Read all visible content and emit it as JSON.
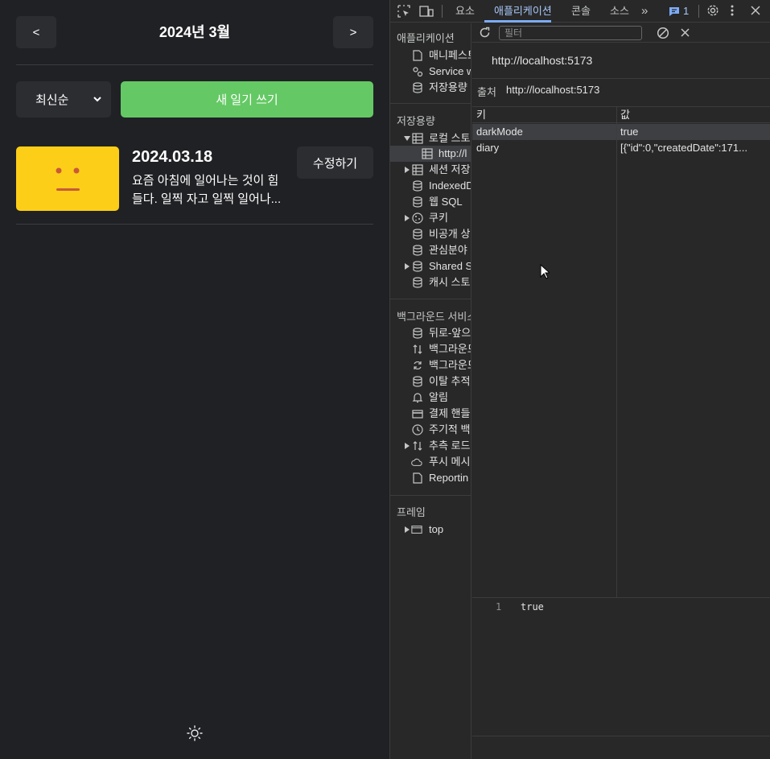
{
  "app": {
    "header": {
      "prev": "<",
      "title": "2024년 3월",
      "next": ">"
    },
    "sort": {
      "selected": "최신순"
    },
    "new_button": "새 일기 쓰기",
    "diary_item": {
      "date": "2024.03.18",
      "content": "요즘 아침에 일어나는 것이 힘들다. 일찍 자고 일찍 일어나...",
      "edit_button": "수정하기",
      "emotion_color": "#fdce17"
    },
    "theme_icon": "sun-icon"
  },
  "devtools": {
    "tabs": [
      "요소",
      "애플리케이션",
      "콘솔",
      "소스"
    ],
    "active_tab": "애플리케이션",
    "more_tabs": "»",
    "issues_count": "1",
    "sidebar": {
      "application_header": "애플리케이션",
      "application_items": [
        "매니페스트",
        "Service w",
        "저장용량"
      ],
      "storage_header": "저장용량",
      "storage_items": [
        "로컬 스토",
        "http://l",
        "세션 저장",
        "IndexedD",
        "웹 SQL",
        "쿠키",
        "비공개 상",
        "관심분야",
        "Shared S",
        "캐시 스토"
      ],
      "background_header": "백그라운드 서비스",
      "background_items": [
        "뒤로-앞으",
        "백그라운드",
        "백그라운드",
        "이탈 추적",
        "알림",
        "결제 핸들",
        "주기적 백",
        "추측 로드",
        "푸시 메시",
        "Reportin"
      ],
      "frames_header": "프레임",
      "frames_items": [
        "top"
      ]
    },
    "toolbar": {
      "filter_placeholder": "필터"
    },
    "origin_title": "http://localhost:5173",
    "origin_label": "출처",
    "origin_value": "http://localhost:5173",
    "table": {
      "headers": [
        "키",
        "값"
      ],
      "rows": [
        {
          "key": "darkMode",
          "value": "true"
        },
        {
          "key": "diary",
          "value": "[{\"id\":0,\"createdDate\":171..."
        }
      ]
    },
    "preview": {
      "line": "1",
      "value": "true"
    }
  }
}
